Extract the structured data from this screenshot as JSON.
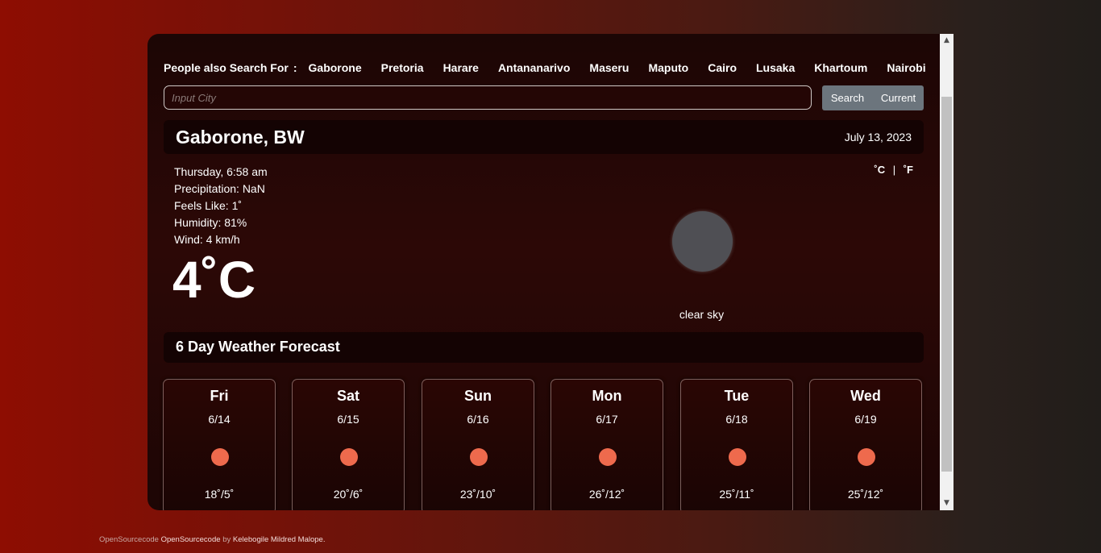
{
  "suggestions": {
    "label": "People also Search For",
    "separator": ":",
    "cities": [
      "Gaborone",
      "Pretoria",
      "Harare",
      "Antananarivo",
      "Maseru",
      "Maputo",
      "Cairo",
      "Lusaka",
      "Khartoum",
      "Nairobi"
    ]
  },
  "search": {
    "placeholder": "Input City",
    "value": "",
    "search_label": "Search",
    "current_label": "Current"
  },
  "current": {
    "city": "Gaborone, BW",
    "date": "July 13, 2023",
    "datetime": "Thursday, 6:58 am",
    "precipitation": "Precipitation: NaN",
    "feels_like": "Feels Like: 1˚",
    "humidity": "Humidity: 81%",
    "wind": "Wind: 4 km/h",
    "temperature": "4˚C",
    "description": "clear sky",
    "icon": "weather-icon",
    "units": {
      "celsius": "˚C",
      "separator": "|",
      "fahrenheit": "˚F"
    }
  },
  "forecast": {
    "title": "6 Day Weather Forecast",
    "days": [
      {
        "day": "Fri",
        "date": "6/14",
        "temps": "18˚/5˚",
        "icon": "sun-icon"
      },
      {
        "day": "Sat",
        "date": "6/15",
        "temps": "20˚/6˚",
        "icon": "sun-icon"
      },
      {
        "day": "Sun",
        "date": "6/16",
        "temps": "23˚/10˚",
        "icon": "sun-icon"
      },
      {
        "day": "Mon",
        "date": "6/17",
        "temps": "26˚/12˚",
        "icon": "sun-icon"
      },
      {
        "day": "Tue",
        "date": "6/18",
        "temps": "25˚/11˚",
        "icon": "sun-icon"
      },
      {
        "day": "Wed",
        "date": "6/19",
        "temps": "25˚/12˚",
        "icon": "sun-icon"
      }
    ]
  },
  "footer": {
    "prefix": "OpenSourcecode",
    "link": "OpenSourcecode",
    "by": "by",
    "author": "Kelebogile Mildred Malope."
  },
  "colors": {
    "accent_button": "#6c757d",
    "sun": "#ee6a4d",
    "bar_background": "#140303"
  }
}
